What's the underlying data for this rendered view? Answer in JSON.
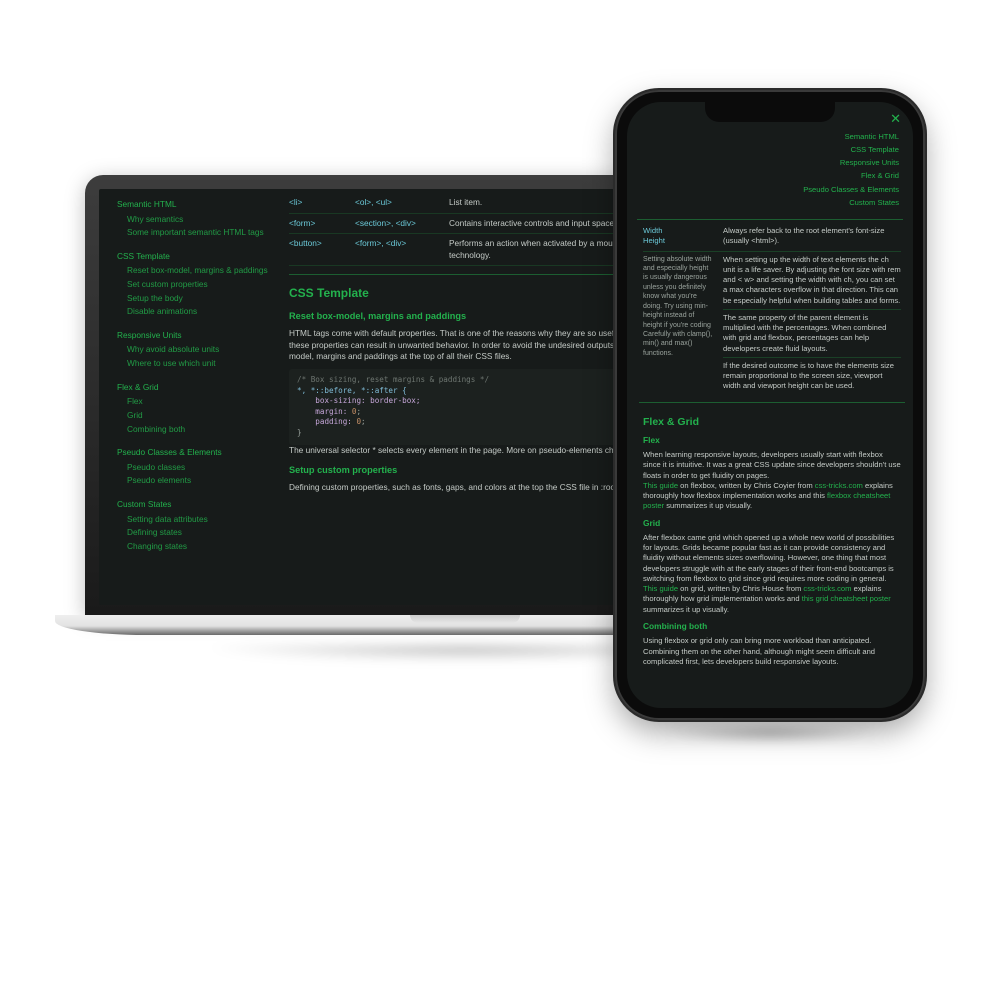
{
  "nav": {
    "sections": [
      {
        "head": "Semantic HTML",
        "subs": [
          "Why semantics",
          "Some important semantic HTML tags"
        ]
      },
      {
        "head": "CSS Template",
        "subs": [
          "Reset box-model, margins & paddings",
          "Set custom properties",
          "Setup the body",
          "Disable animations"
        ]
      },
      {
        "head": "Responsive Units",
        "subs": [
          "Why avoid absolute units",
          "Where to use which unit"
        ]
      },
      {
        "head": "Flex & Grid",
        "subs": [
          "Flex",
          "Grid",
          "Combining both"
        ]
      },
      {
        "head": "Pseudo Classes & Elements",
        "subs": [
          "Pseudo classes",
          "Pseudo elements"
        ]
      },
      {
        "head": "Custom States",
        "subs": [
          "Setting data attributes",
          "Defining states",
          "Changing states"
        ]
      }
    ]
  },
  "tags": [
    {
      "el": "<li>",
      "parent": "<ol>, <ul>",
      "desc": "List item."
    },
    {
      "el": "<form>",
      "parent": "<section>, <div>",
      "desc": "Contains interactive controls and input spaces for submitting information."
    },
    {
      "el": "<button>",
      "parent": "<form>, <div>",
      "desc": "Performs an action when activated by a mouse, keyboard, finger, voice command, or other assistive technology."
    }
  ],
  "cssTemplate": {
    "heading": "CSS Template",
    "sub1": "Reset box-model, margins and paddings",
    "p1": "HTML tags come with default properties. That is one of the reasons why they are so useful. However, when adjusting layouts and whitespaces, these properties can result in unwanted behavior. In order to avoid the undesired outputs this situation brings, most developers reset their box-model, margins and paddings at the top of all their CSS files.",
    "p1b": "The universal selector * selects every element in the page. More on pseudo-elements chapter.",
    "sub2": "Setup custom properties",
    "p2": "Defining custom properties, such as fonts, gaps, and colors at the top the CSS file in :root can increase the developer's efficiency immensely."
  },
  "code": {
    "comment": "/* Box sizing, reset margins & paddings */",
    "selLine": "*, *::before, *::after {",
    "l1": "box-sizing: border-box;",
    "l2": "margin: 0;",
    "l3": "padding: 0;",
    "close": "}"
  },
  "phone": {
    "close": "✕",
    "nav": [
      "Semantic HTML",
      "CSS Template",
      "Responsive Units",
      "Flex & Grid",
      "Pseudo Classes & Elements",
      "Custom States"
    ],
    "units": [
      {
        "left": "Width\nHeight",
        "lnote": "Setting absolute width and especially height is usually dangerous unless you definitely know what you're doing. Try using min-height instead of height if you're coding Carefully with clamp(), min() and max() functions.",
        "right0": "Always refer back to the root element's font-size (usually <html>).",
        "right1": "When setting up the width of text elements the ch unit is a life saver. By adjusting the font size with rem and < w> and setting the width with ch, you can set a max characters overflow in that direction. This can be especially helpful when building tables and forms.",
        "right2": "The same property of the parent element is multiplied with the percentages. When combined with grid and flexbox, percentages can help developers create fluid layouts.",
        "right3": "If the desired outcome is to have the elements size remain proportional to the screen size, viewport width and viewport height can be used."
      }
    ],
    "flexgrid": {
      "heading": "Flex & Grid",
      "flexH": "Flex",
      "flexP1": "When learning responsive layouts, developers usually start with flexbox since it is intuitive. It was a great CSS update since developers shouldn't use floats in order to get fluidity on pages.",
      "flexP2a": "This guide",
      "flexP2b": " on flexbox, written by Chris Coyier from ",
      "flexP2c": "css-tricks.com",
      "flexP2d": " explains thoroughly how flexbox implementation works and this ",
      "flexP2e": "flexbox cheatsheet poster",
      "flexP2f": " summarizes it up visually.",
      "gridH": "Grid",
      "gridP": "After flexbox came grid which opened up a whole new world of possibilities for layouts. Grids became popular fast as it can provide consistency and fluidity without elements sizes overflowing. However, one thing that most developers struggle with at the early stages of their front-end bootcamps is switching from flexbox to grid since grid requires more coding in general.",
      "gridP2a": "This guide",
      "gridP2b": " on grid, written by Chris House from ",
      "gridP2c": "css-tricks.com",
      "gridP2d": " explains thoroughly how grid implementation works and ",
      "gridP2e": "this grid cheatsheet poster",
      "gridP2f": " summarizes it up visually.",
      "combH": "Combining both",
      "combP": "Using flexbox or grid only can bring more workload than anticipated. Combining them on the other hand, although might seem difficult and complicated first, lets developers build responsive layouts."
    }
  }
}
